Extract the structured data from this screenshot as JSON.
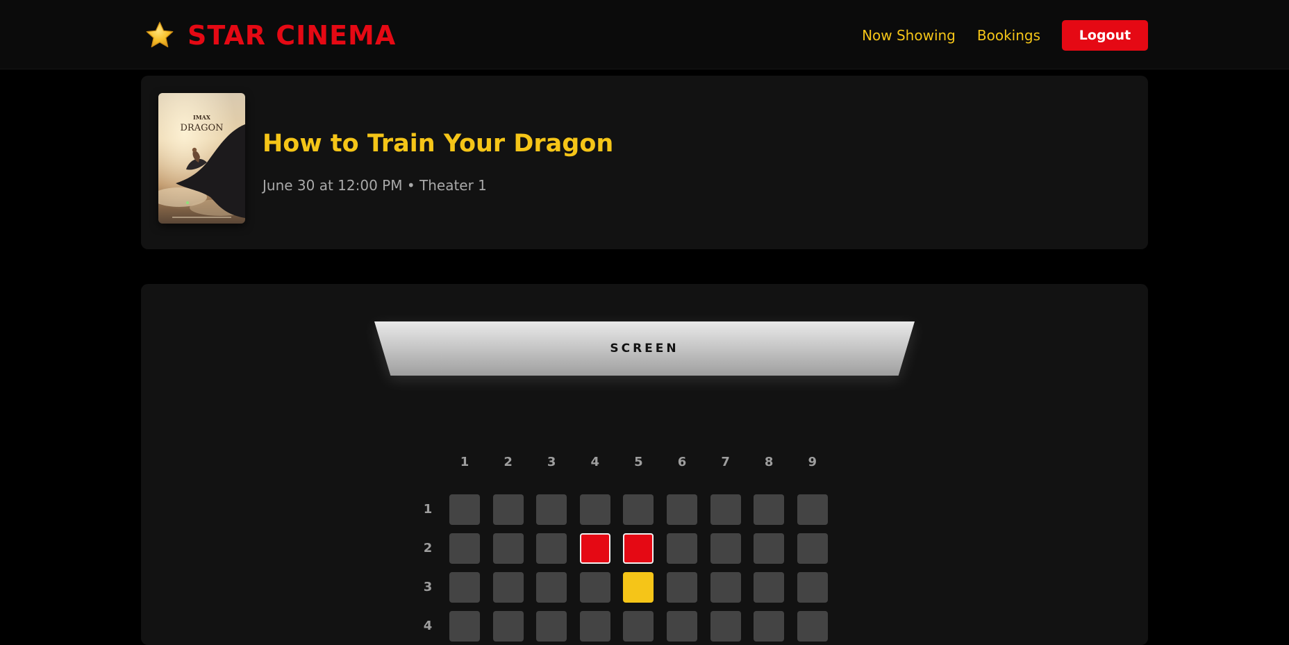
{
  "nav": {
    "brand": "STAR CINEMA",
    "brand_icon": "star-icon",
    "links": [
      "Now Showing",
      "Bookings"
    ],
    "logout_label": "Logout"
  },
  "movie": {
    "title": "How to Train Your Dragon",
    "meta": "June 30 at 12:00 PM • Theater 1",
    "poster_lettering": [
      "IMAX",
      "DRAGON"
    ]
  },
  "seating": {
    "screen_label": "SCREEN",
    "columns": [
      "1",
      "2",
      "3",
      "4",
      "5",
      "6",
      "7",
      "8",
      "9"
    ],
    "rows": [
      {
        "label": "1",
        "seats": [
          "available",
          "available",
          "available",
          "available",
          "available",
          "available",
          "available",
          "available",
          "available"
        ]
      },
      {
        "label": "2",
        "seats": [
          "available",
          "available",
          "available",
          "taken",
          "taken",
          "available",
          "available",
          "available",
          "available"
        ]
      },
      {
        "label": "3",
        "seats": [
          "available",
          "available",
          "available",
          "available",
          "selected",
          "available",
          "available",
          "available",
          "available"
        ]
      },
      {
        "label": "4",
        "seats": [
          "available",
          "available",
          "available",
          "available",
          "available",
          "available",
          "available",
          "available",
          "available"
        ]
      }
    ]
  },
  "colors": {
    "brand_red": "#e50914",
    "accent_yellow": "#f5c518",
    "seat_available": "#444444",
    "seat_taken": "#e50914",
    "seat_selected": "#f5c518"
  }
}
